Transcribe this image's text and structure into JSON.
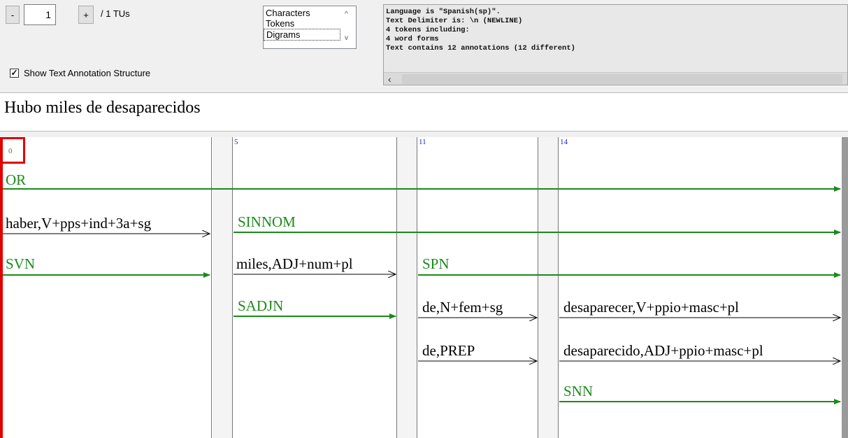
{
  "tu_nav": {
    "minus": "-",
    "value": "1",
    "plus": "+",
    "total": "/ 1 TUs"
  },
  "display_list": {
    "items": [
      "Characters",
      "Tokens",
      "Digrams"
    ]
  },
  "info": {
    "lines": [
      "Language is \"Spanish(sp)\".",
      "Text Delimiter is: \\n (NEWLINE)",
      "4 tokens including:",
      "4 word forms",
      "Text contains 12 annotations (12 different)"
    ]
  },
  "show_structure": {
    "label": "Show Text Annotation Structure",
    "checked": true
  },
  "sentence": "Hubo miles de desaparecidos",
  "offsets": [
    "0",
    "5",
    "11",
    "14"
  ],
  "annotations": {
    "or": "OR",
    "haber": "haber,V+pps+ind+3a+sg",
    "sinnom": "SINNOM",
    "svn": "SVN",
    "miles": "miles,ADJ+num+pl",
    "spn": "SPN",
    "sadjn": "SADJN",
    "de_n": "de,N+fem+sg",
    "desaparecer": "desaparecer,V+ppio+masc+pl",
    "de_prep": "de,PREP",
    "desaparecido": "desaparecido,ADJ+ppio+masc+pl",
    "snn": "SNN"
  },
  "colors": {
    "green": "#1b8a1b",
    "black": "#000000",
    "highlight": "#e00000"
  }
}
